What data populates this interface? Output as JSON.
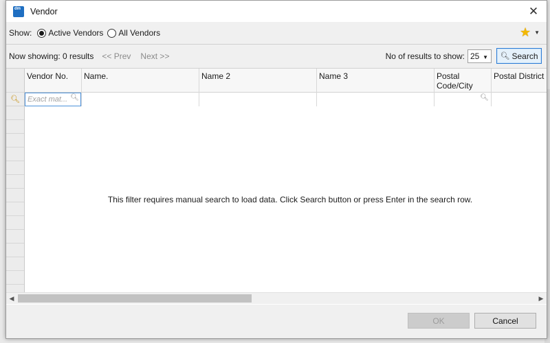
{
  "window": {
    "title": "Vendor",
    "logo_text": "dm"
  },
  "show_filter": {
    "label": "Show:",
    "options": [
      {
        "label": "Active Vendors",
        "selected": true
      },
      {
        "label": "All Vendors",
        "selected": false
      }
    ]
  },
  "toolbar": {
    "now_showing": "Now showing: 0 results",
    "prev_label": "<< Prev",
    "next_label": "Next >>",
    "results_label": "No of results to show:",
    "results_value": "25",
    "search_label": "Search"
  },
  "grid": {
    "columns": [
      {
        "label": "Vendor No."
      },
      {
        "label": "Name."
      },
      {
        "label": "Name 2"
      },
      {
        "label": "Name 3"
      },
      {
        "label": "Postal Code/City"
      },
      {
        "label": "Postal District"
      }
    ],
    "filter_placeholder": "Exact mat...",
    "empty_message": "This filter requires manual search to load data. Click Search button or press Enter in the search row."
  },
  "footer": {
    "ok_label": "OK",
    "cancel_label": "Cancel"
  },
  "colors": {
    "accent": "#2a7bd6",
    "star": "#f3b800",
    "logo": "#1f6fc2"
  }
}
